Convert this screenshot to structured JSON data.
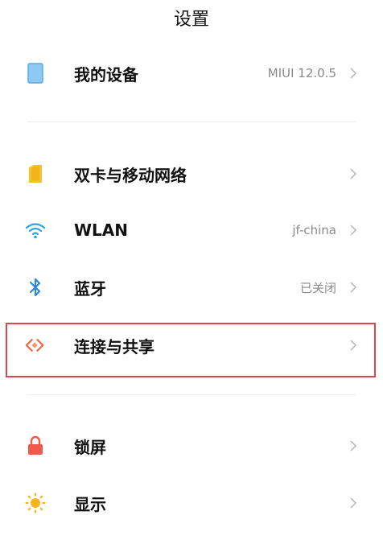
{
  "header": {
    "title": "设置"
  },
  "items": [
    {
      "label": "我的设备",
      "value": "MIUI 12.0.5",
      "icon": "device-icon",
      "color": "#5aa9e6"
    },
    {
      "label": "双卡与移动网络",
      "value": "",
      "icon": "sim-card-icon",
      "color": "#f5b90f"
    },
    {
      "label": "WLAN",
      "value": "jf-china",
      "icon": "wifi-icon",
      "color": "#2aa3e8"
    },
    {
      "label": "蓝牙",
      "value": "已关闭",
      "icon": "bluetooth-icon",
      "color": "#2e86de"
    },
    {
      "label": "连接与共享",
      "value": "",
      "icon": "connection-sharing-icon",
      "color": "#ee6a45"
    },
    {
      "label": "锁屏",
      "value": "",
      "icon": "lock-icon",
      "color": "#ef5a4b"
    },
    {
      "label": "显示",
      "value": "",
      "icon": "sun-icon",
      "color": "#f7b51b"
    }
  ],
  "highlight_color": "#d9484f"
}
